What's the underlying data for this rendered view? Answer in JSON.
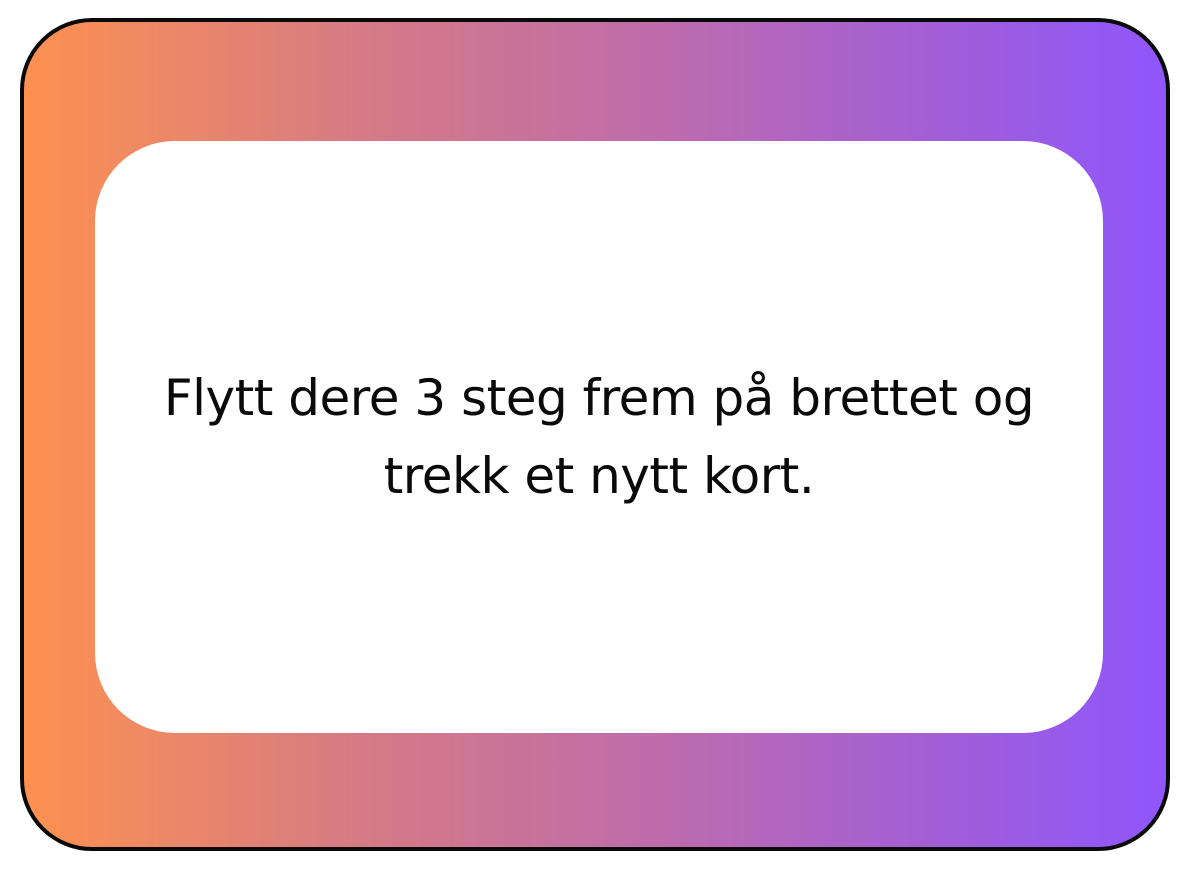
{
  "card": {
    "text": "Flytt dere 3 steg frem på brettet og trekk et nytt kort.",
    "gradient_start": "#fd9150",
    "gradient_end": "#8f56fb",
    "border_color": "#0a0a0a",
    "panel_color": "#ffffff"
  }
}
